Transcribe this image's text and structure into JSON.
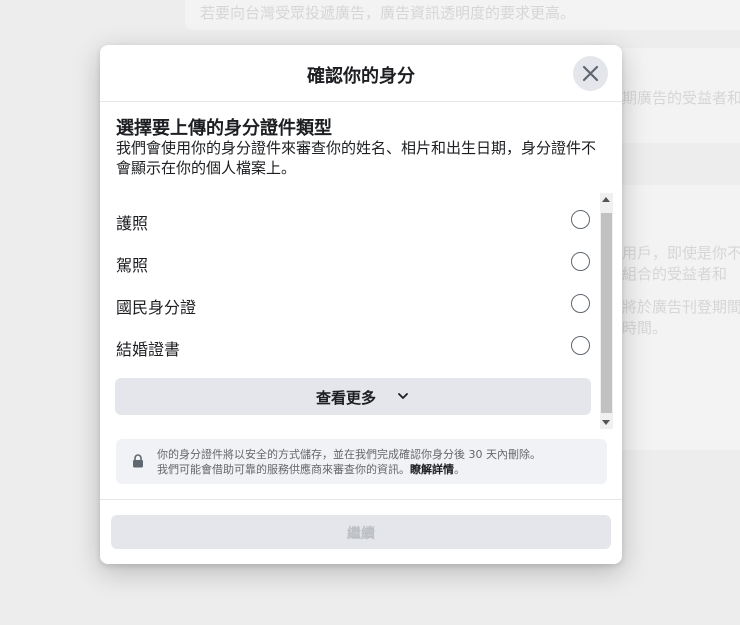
{
  "background": {
    "line1": "若要向台灣受眾投遞廣告，廣告資訊透明度的要求更高。",
    "line2": "期廣告的受益者和",
    "line3": "用戶，即使是你不",
    "line4": "組合的受益者和",
    "line5": "將於廣告刊登期間",
    "line6": "時間。"
  },
  "modal": {
    "title": "確認你的身分",
    "heading": "選擇要上傳的身分證件類型",
    "description": "我們會使用你的身分證件來審查你的姓名、相片和出生日期，身分證件不會顯示在你的個人檔案上。",
    "options": [
      {
        "label": "護照"
      },
      {
        "label": "駕照"
      },
      {
        "label": "國民身分證"
      },
      {
        "label": "結婚證書"
      }
    ],
    "see_more": "查看更多",
    "privacy": {
      "line1": "你的身分證件將以安全的方式儲存，並在我們完成確認你身分後 30 天內刪除。",
      "line2": "我們可能會借助可靠的服務供應商來審查你的資訊。",
      "learn_more": "瞭解詳情",
      "period": "。"
    },
    "continue": "繼續"
  }
}
